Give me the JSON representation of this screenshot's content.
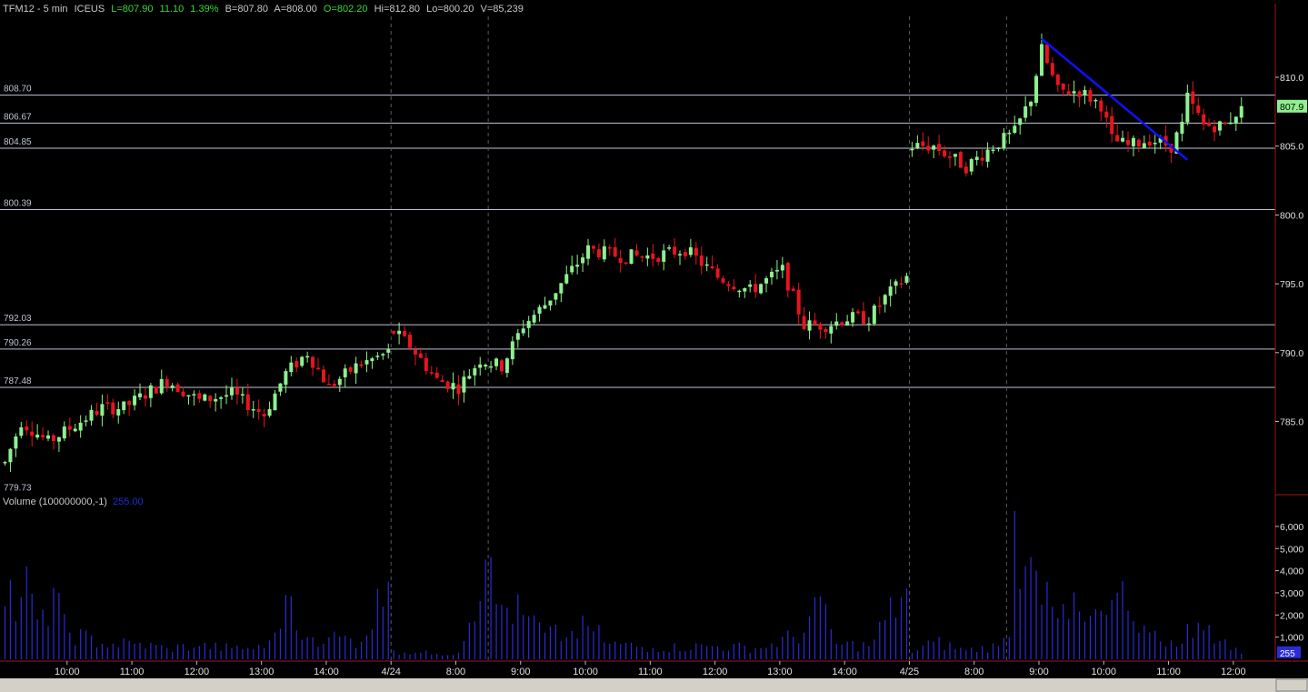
{
  "header": {
    "symbol": "TFM12 - 5 min",
    "exchange": "ICEUS",
    "last": "L=807.90",
    "change": "11.10",
    "change_pct": "1.39%",
    "bid": "B=807.80",
    "ask": "A=808.00",
    "open": "O=802.20",
    "high": "Hi=812.80",
    "low": "Lo=800.20",
    "volume": "V=85,239"
  },
  "volume_panel": {
    "label": "Volume (100000000,-1)",
    "scale_value": "255.00",
    "current_volume": "255"
  },
  "colors": {
    "background": "#000000",
    "up_candle": "#8ef08e",
    "down_candle": "#e8141e",
    "volume_bar": "#2b2bd8",
    "trendline": "#1010ff",
    "level_line": "#bfc4d6",
    "session_divider": "#5a5a5a",
    "axis_frame": "#9b1a1a",
    "last_price_tag": "#8ef08e"
  },
  "chart_data": {
    "type": "candlestick",
    "title": "",
    "price_axis": {
      "min": 779.73,
      "max": 813.0,
      "ticks": [
        "785.0",
        "790.0",
        "795.0",
        "800.0",
        "805.0",
        "810.0"
      ],
      "tick_values": [
        785.0,
        790.0,
        795.0,
        800.0,
        805.0,
        810.0
      ]
    },
    "last_price_tag": "807.9",
    "level_lines": [
      {
        "label": "808.70",
        "value": 808.7
      },
      {
        "label": "806.67",
        "value": 806.67
      },
      {
        "label": "804.85",
        "value": 804.85
      },
      {
        "label": "800.39",
        "value": 800.39
      },
      {
        "label": "792.03",
        "value": 792.03
      },
      {
        "label": "790.26",
        "value": 790.26
      },
      {
        "label": "787.48",
        "value": 787.48
      },
      {
        "label": "779.73",
        "value": 779.73
      }
    ],
    "volume_axis": {
      "min": 0,
      "max": 7000,
      "ticks": [
        "1,000",
        "2,000",
        "3,000",
        "4,000",
        "5,000",
        "6,000"
      ],
      "tick_values": [
        1000,
        2000,
        3000,
        4000,
        5000,
        6000
      ]
    },
    "time_axis": {
      "labels": [
        "10:00",
        "11:00",
        "12:00",
        "13:00",
        "14:00",
        "4/24",
        "8:00",
        "9:00",
        "10:00",
        "11:00",
        "12:00",
        "13:00",
        "14:00",
        "4/25",
        "8:00",
        "9:00",
        "10:00",
        "11:00",
        "12:00"
      ],
      "label_bars": [
        12,
        24,
        36,
        48,
        60,
        72,
        84,
        96,
        108,
        120,
        132,
        144,
        156,
        168,
        180,
        192,
        204,
        216,
        228
      ],
      "divider_bars": [
        72,
        90,
        168,
        186
      ]
    },
    "session1_anchors": [
      [
        0,
        782.0
      ],
      [
        3,
        785.0
      ],
      [
        8,
        783.5
      ],
      [
        12,
        784.5
      ],
      [
        18,
        786.0
      ],
      [
        22,
        786.0
      ],
      [
        30,
        788.0
      ],
      [
        36,
        786.5
      ],
      [
        42,
        787.0
      ],
      [
        48,
        785.5
      ],
      [
        52,
        788.5
      ],
      [
        56,
        790.0
      ],
      [
        60,
        787.5
      ],
      [
        65,
        789.0
      ],
      [
        71,
        790.0
      ]
    ],
    "session2_anchors": [
      [
        72,
        791.5
      ],
      [
        75,
        790.5
      ],
      [
        80,
        788.0
      ],
      [
        84,
        787.5
      ],
      [
        88,
        789.5
      ],
      [
        92,
        789.0
      ],
      [
        96,
        792.0
      ],
      [
        100,
        793.5
      ],
      [
        104,
        795.5
      ],
      [
        108,
        797.5
      ],
      [
        114,
        797.0
      ],
      [
        120,
        797.0
      ],
      [
        126,
        797.5
      ],
      [
        132,
        795.5
      ],
      [
        138,
        794.5
      ],
      [
        144,
        796.0
      ],
      [
        148,
        792.0
      ],
      [
        152,
        792.0
      ],
      [
        156,
        792.5
      ],
      [
        160,
        792.5
      ],
      [
        163,
        794.0
      ],
      [
        167,
        795.5
      ]
    ],
    "session3_anchors": [
      [
        168,
        805.0
      ],
      [
        172,
        805.0
      ],
      [
        176,
        804.0
      ],
      [
        178,
        803.5
      ],
      [
        183,
        805.0
      ],
      [
        187,
        806.0
      ],
      [
        190,
        808.5
      ],
      [
        192,
        812.0
      ],
      [
        195,
        809.0
      ],
      [
        199,
        809.0
      ],
      [
        203,
        808.0
      ],
      [
        205,
        805.5
      ],
      [
        208,
        805.0
      ],
      [
        212,
        805.5
      ],
      [
        216,
        805.0
      ],
      [
        218,
        806.5
      ],
      [
        219,
        808.5
      ],
      [
        222,
        806.5
      ],
      [
        226,
        806.5
      ],
      [
        229,
        807.9
      ]
    ],
    "volume_profile": [
      [
        0,
        2400
      ],
      [
        3,
        2800
      ],
      [
        4,
        4200
      ],
      [
        6,
        1800
      ],
      [
        8,
        1500
      ],
      [
        10,
        3000
      ],
      [
        12,
        1200
      ],
      [
        18,
        700
      ],
      [
        24,
        700
      ],
      [
        30,
        500
      ],
      [
        36,
        600
      ],
      [
        42,
        500
      ],
      [
        48,
        500
      ],
      [
        50,
        1200
      ],
      [
        52,
        2900
      ],
      [
        54,
        1300
      ],
      [
        56,
        1000
      ],
      [
        60,
        1000
      ],
      [
        66,
        800
      ],
      [
        71,
        3500
      ],
      [
        72,
        400
      ],
      [
        76,
        300
      ],
      [
        80,
        250
      ],
      [
        84,
        300
      ],
      [
        89,
        4500
      ],
      [
        91,
        2500
      ],
      [
        96,
        2000
      ],
      [
        100,
        1200
      ],
      [
        104,
        1000
      ],
      [
        108,
        1500
      ],
      [
        112,
        700
      ],
      [
        120,
        500
      ],
      [
        130,
        600
      ],
      [
        140,
        500
      ],
      [
        148,
        1200
      ],
      [
        150,
        2800
      ],
      [
        154,
        700
      ],
      [
        160,
        600
      ],
      [
        166,
        2800
      ],
      [
        167,
        3200
      ],
      [
        168,
        300
      ],
      [
        172,
        800
      ],
      [
        178,
        400
      ],
      [
        184,
        600
      ],
      [
        186,
        1000
      ],
      [
        187,
        6700
      ],
      [
        189,
        4200
      ],
      [
        191,
        4000
      ],
      [
        193,
        3500
      ],
      [
        196,
        2500
      ],
      [
        200,
        1700
      ],
      [
        204,
        2000
      ],
      [
        206,
        3000
      ],
      [
        210,
        1200
      ],
      [
        214,
        800
      ],
      [
        218,
        700
      ],
      [
        219,
        1600
      ],
      [
        222,
        1300
      ],
      [
        226,
        900
      ],
      [
        229,
        255
      ]
    ],
    "trendline": {
      "start": {
        "bar": 192,
        "price": 812.8
      },
      "end": {
        "bar": 219,
        "price": 804.0
      }
    }
  }
}
